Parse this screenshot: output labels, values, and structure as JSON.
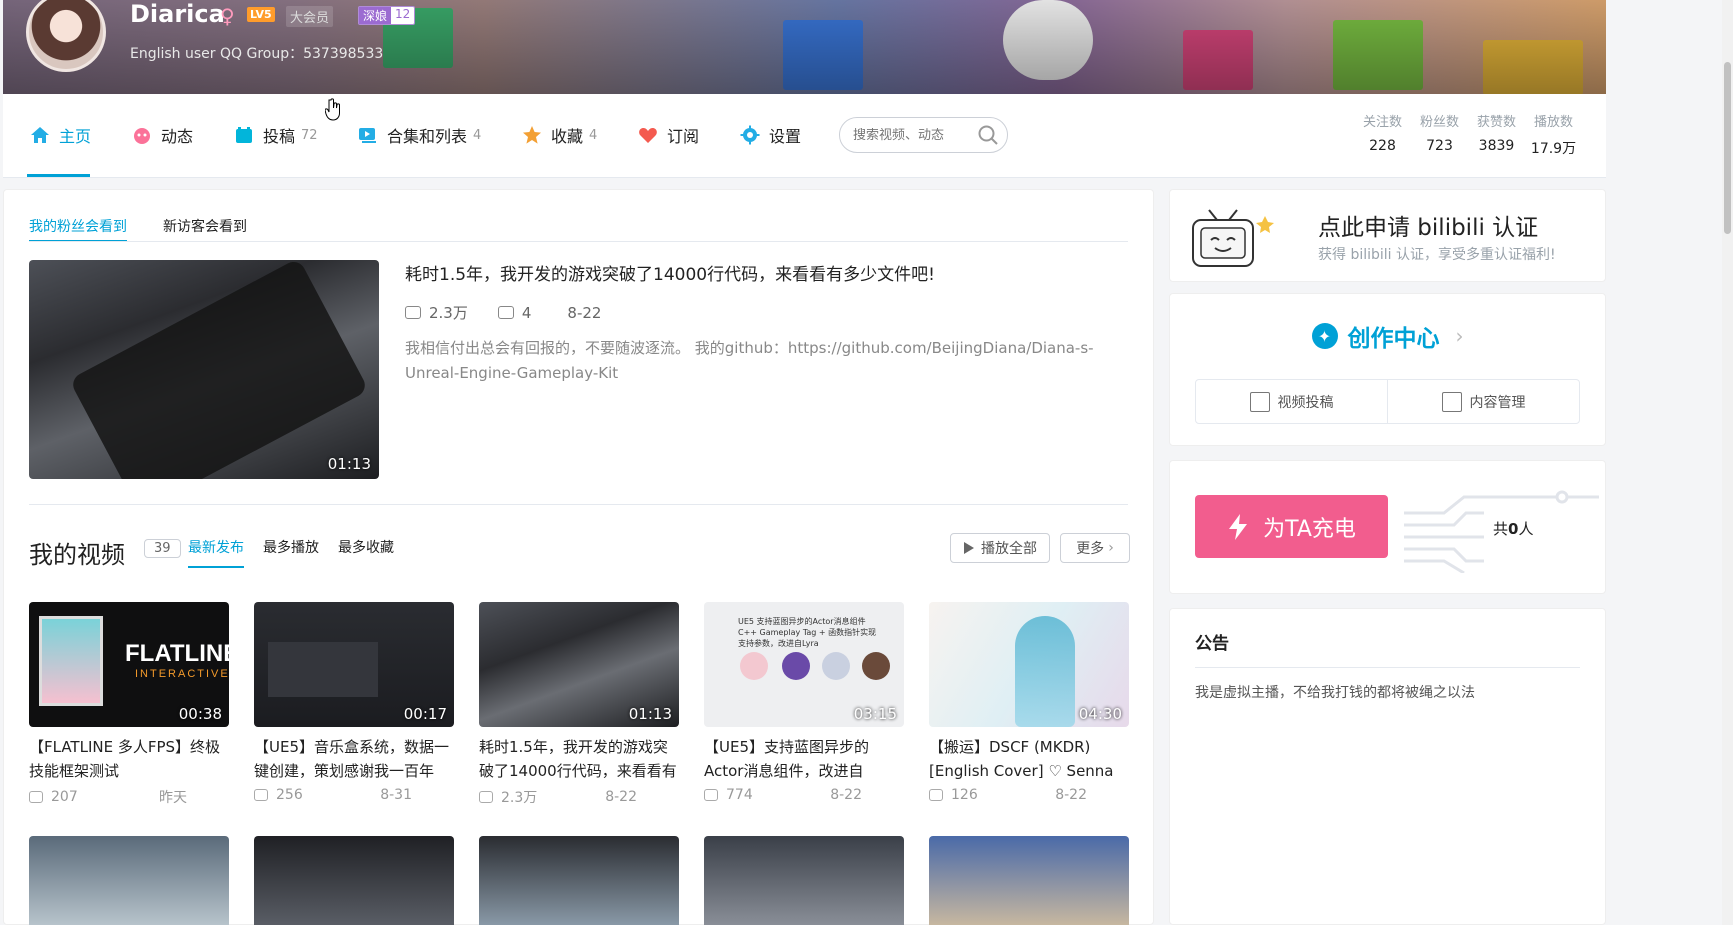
{
  "header": {
    "username": "Diarica",
    "gender_symbol": "♀",
    "level": "LV5",
    "vip": "大会员",
    "medal_name": "深娘",
    "medal_level": "12",
    "sign": "English user QQ Group：537398533"
  },
  "nav": {
    "home": "主页",
    "dynamic": "动态",
    "upload": "投稿",
    "upload_count": "72",
    "collections": "合集和列表",
    "collections_count": "4",
    "favorites": "收藏",
    "favorites_count": "4",
    "subscribe": "订阅",
    "settings": "设置",
    "search_placeholder": "搜索视频、动态"
  },
  "stats": [
    {
      "label": "关注数",
      "value": "228"
    },
    {
      "label": "粉丝数",
      "value": "723"
    },
    {
      "label": "获赞数",
      "value": "3839"
    },
    {
      "label": "播放数",
      "value": "17.9万"
    }
  ],
  "featured": {
    "tab_fans": "我的粉丝会看到",
    "tab_visitors": "新访客会看到",
    "title": "耗时1.5年，我开发的游戏突破了14000行代码，来看看有多少文件吧!",
    "views": "2.3万",
    "comments": "4",
    "date": "8-22",
    "duration": "01:13",
    "description": "我相信付出总会有回报的，不要随波逐流。 我的github：https://github.com/BeijingDiana/Diana-s-Unreal-Engine-Gameplay-Kit"
  },
  "videos_section": {
    "title": "我的视频",
    "count": "39",
    "sort_latest": "最新发布",
    "sort_plays": "最多播放",
    "sort_favs": "最多收藏",
    "play_all": "播放全部",
    "more": "更多"
  },
  "videos": [
    {
      "title": "【FLATLINE 多人FPS】终极技能框架测试",
      "views": "207",
      "date": "昨天",
      "duration": "00:38",
      "thumb_text1": "FLATLINE",
      "thumb_text2": "INTERACTIVE"
    },
    {
      "title": "【UE5】音乐盒系统，数据一键创建，策划感谢我一百年",
      "views": "256",
      "date": "8-31",
      "duration": "00:17"
    },
    {
      "title": "耗时1.5年，我开发的游戏突破了14000行代码，来看看有",
      "views": "2.3万",
      "date": "8-22",
      "duration": "01:13"
    },
    {
      "title": "【UE5】支持蓝图异步的Actor消息组件，改进自",
      "views": "774",
      "date": "8-22",
      "duration": "03:15",
      "thumb_text1": "UE5 支持蓝图异步的Actor消息组件 C++ Gameplay Tag + 函数指针实现 支持参数，改进自Lyra"
    },
    {
      "title": "【搬运】DSCF (MKDR) [English Cover] ♡ Senna Fox",
      "views": "126",
      "date": "8-22",
      "duration": "04:30"
    }
  ],
  "sidebar": {
    "verify_title": "点此申请 bilibili 认证",
    "verify_sub": "获得 bilibili 认证，享受多重认证福利!",
    "creator_title": "创作中心",
    "creator_upload": "视频投稿",
    "creator_manage": "内容管理",
    "charge_button": "为TA充电",
    "charge_prefix": "共",
    "charge_count": "0",
    "charge_suffix": "人",
    "notice_title": "公告",
    "notice_content": "我是虚拟主播，不给我打钱的都将被绳之以法"
  },
  "colors": {
    "accent": "#00a1d6",
    "charge": "#f25d8e"
  }
}
